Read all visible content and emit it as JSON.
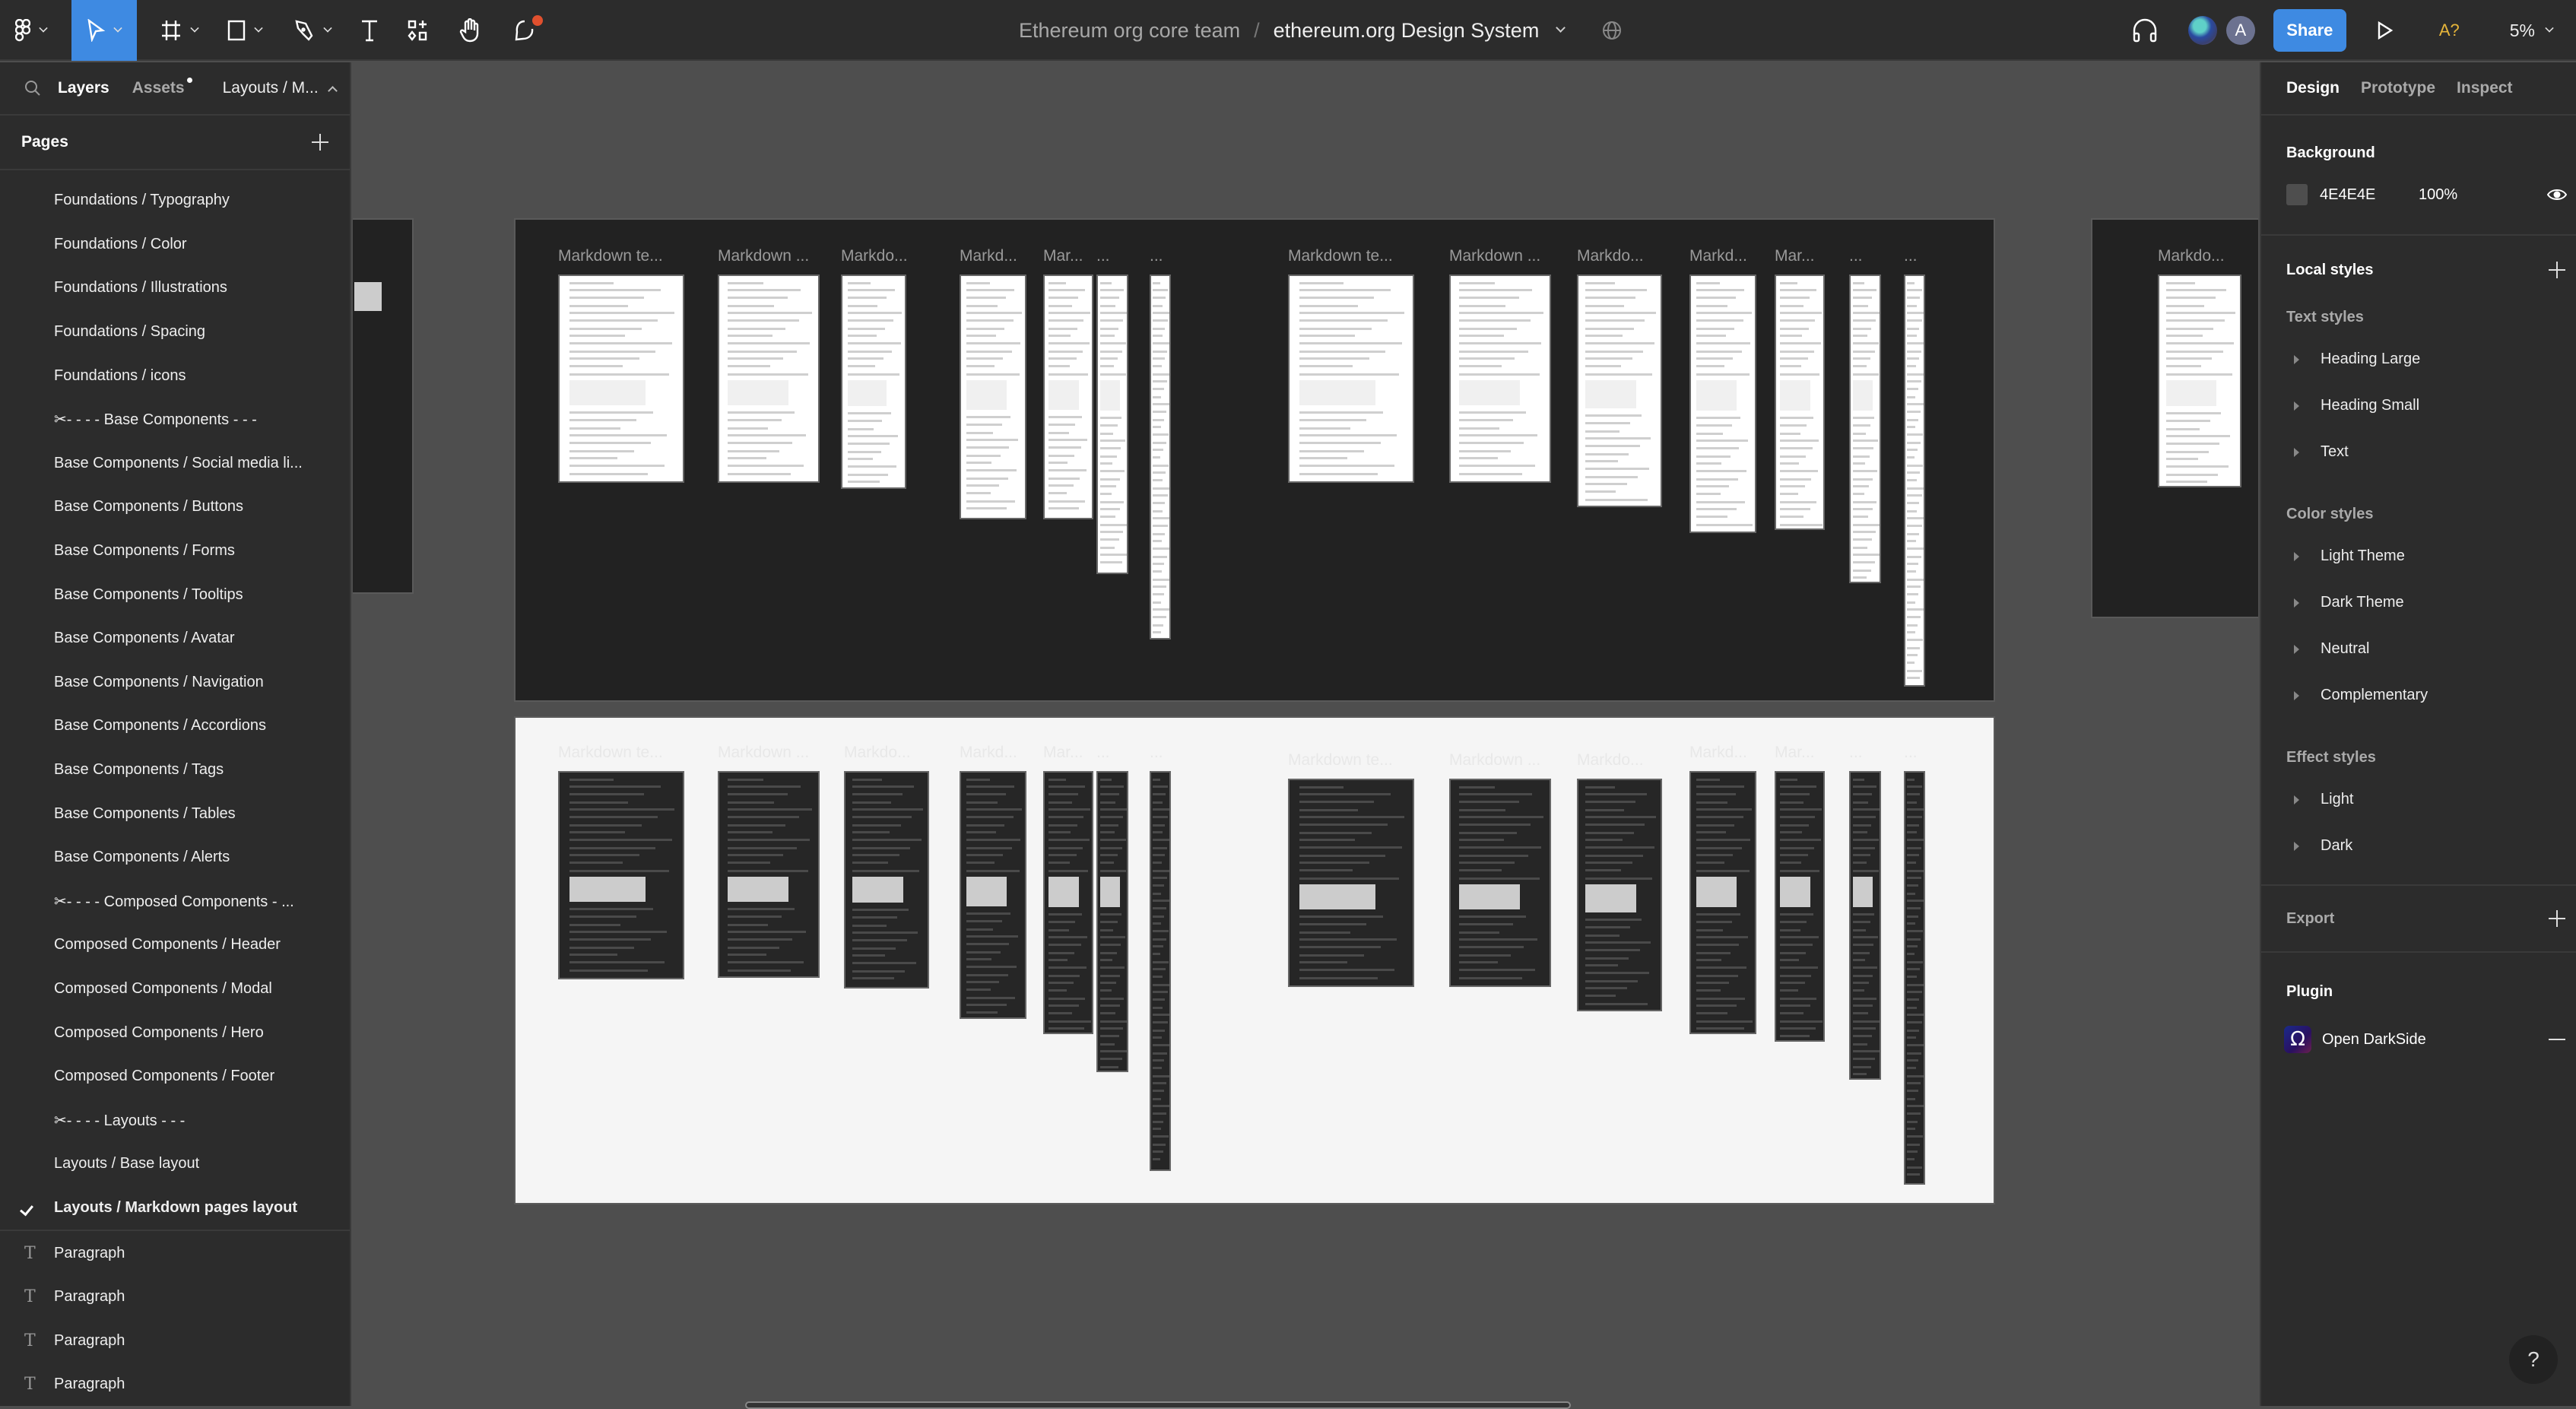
{
  "toolbar": {
    "tools": [
      {
        "name": "main-menu",
        "icon": "figma-logo-icon"
      },
      {
        "name": "move",
        "icon": "cursor-icon",
        "active": true
      },
      {
        "name": "frame",
        "icon": "frame-icon"
      },
      {
        "name": "shape",
        "icon": "rectangle-icon"
      },
      {
        "name": "pen",
        "icon": "pen-icon"
      },
      {
        "name": "text",
        "icon": "text-icon"
      },
      {
        "name": "resources",
        "icon": "resources-icon"
      },
      {
        "name": "hand",
        "icon": "hand-icon"
      },
      {
        "name": "comment",
        "icon": "comment-icon"
      }
    ],
    "team": "Ethereum org core team",
    "separator": "/",
    "file_name": "ethereum.org Design System",
    "share_label": "Share",
    "avatar_initial": "A",
    "a11y_label": "A?",
    "zoom": "5%",
    "accent": "#3e8ae2"
  },
  "left_panel": {
    "tabs": {
      "layers": "Layers",
      "assets": "Assets"
    },
    "current_page_short": "Layouts / M...",
    "pages_title": "Pages",
    "pages": [
      "Foundations / Typography",
      "Foundations / Color",
      "Foundations / Illustrations",
      "Foundations / Spacing",
      "Foundations / icons",
      "✂- - - -  Base Components - - -",
      "Base Components / Social media li...",
      "Base Components / Buttons",
      "Base Components / Forms",
      "Base Components / Tooltips",
      "Base Components / Avatar",
      "Base Components / Navigation",
      "Base Components / Accordions",
      "Base Components / Tags",
      "Base Components / Tables",
      "Base Components / Alerts",
      "✂- - - -  Composed Components - ...",
      "Composed Components / Header",
      "Composed Components / Modal",
      "Composed Components / Hero",
      "Composed Components / Footer",
      "✂- - - - Layouts - - -",
      "Layouts / Base layout",
      "Layouts / Markdown pages layout"
    ],
    "current_page_index": 23,
    "layers": [
      "Paragraph",
      "Paragraph",
      "Paragraph",
      "Paragraph"
    ]
  },
  "canvas": {
    "background": "#4E4E4E",
    "dark_section": {
      "frames": [
        "Markdown te...",
        "Markdown ...",
        "Markdo...",
        "Markd...",
        "Mar...",
        "...",
        "...",
        "Markdown te...",
        "Markdown ...",
        "Markdo...",
        "Markd...",
        "Mar...",
        "...",
        "..."
      ]
    },
    "light_section": {
      "frames": [
        "Markdown te...",
        "Markdown ...",
        "Markdo...",
        "Markd...",
        "Mar...",
        "...",
        "...",
        "Markdown te...",
        "Markdown ...",
        "Markdo...",
        "Markd...",
        "Mar...",
        "...",
        "..."
      ]
    },
    "right_section": {
      "frames": [
        "Markdo..."
      ]
    }
  },
  "right_panel": {
    "tabs": [
      "Design",
      "Prototype",
      "Inspect"
    ],
    "background_title": "Background",
    "background_hex": "4E4E4E",
    "background_opacity": "100%",
    "local_styles_title": "Local styles",
    "text_styles_title": "Text styles",
    "text_styles": [
      "Heading Large",
      "Heading Small",
      "Text"
    ],
    "color_styles_title": "Color styles",
    "color_styles": [
      "Light Theme",
      "Dark Theme",
      "Neutral",
      "Complementary"
    ],
    "effect_styles_title": "Effect styles",
    "effect_styles": [
      "Light",
      "Dark"
    ],
    "export_title": "Export",
    "plugin_title": "Plugin",
    "plugin_name": "Open DarkSide",
    "help_label": "?"
  }
}
